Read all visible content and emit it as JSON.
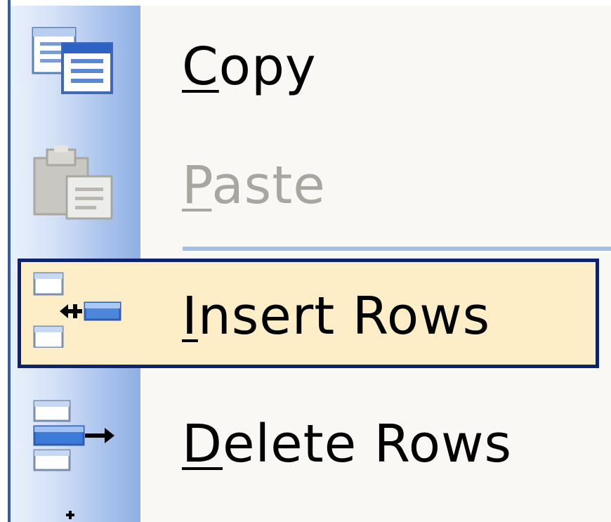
{
  "context_menu": {
    "items": [
      {
        "label_mnemonic": "C",
        "label_rest": "opy",
        "icon": "copy-icon",
        "state": "enabled"
      },
      {
        "label_mnemonic": "P",
        "label_rest": "aste",
        "icon": "paste-icon",
        "state": "disabled"
      },
      {
        "label_mnemonic": "I",
        "label_rest": "nsert Rows",
        "icon": "insert-rows-icon",
        "state": "highlighted"
      },
      {
        "label_mnemonic": "D",
        "label_rest": "elete Rows",
        "icon": "delete-rows-icon",
        "state": "enabled"
      }
    ]
  },
  "colors": {
    "menu_background": "#f9f8f4",
    "gutter_gradient_start": "#eaf1fc",
    "gutter_gradient_end": "#8fb0e4",
    "highlight_fill": "#fdeec7",
    "highlight_border": "#0d236f",
    "disabled_text": "#a7a69f",
    "separator": "#a6bde6",
    "frame_border": "#2f5bb4"
  }
}
